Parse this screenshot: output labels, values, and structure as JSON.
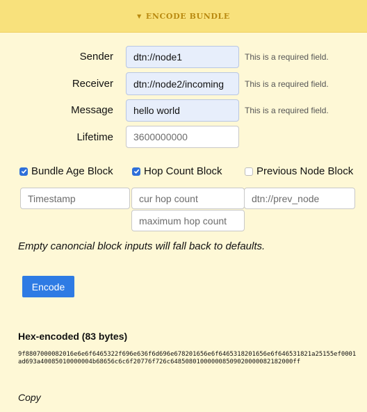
{
  "header": {
    "caret": "▼",
    "title": "ENCODE BUNDLE"
  },
  "form": {
    "sender": {
      "label": "Sender",
      "value": "dtn://node1",
      "hint": "This is a required field."
    },
    "receiver": {
      "label": "Receiver",
      "value": "dtn://node2/incoming",
      "hint": "This is a required field."
    },
    "message": {
      "label": "Message",
      "value": "hello world",
      "hint": "This is a required field."
    },
    "lifetime": {
      "label": "Lifetime",
      "placeholder": "3600000000"
    }
  },
  "blocks": {
    "bundle_age": {
      "label": "Bundle Age Block",
      "checked": true,
      "timestamp_placeholder": "Timestamp"
    },
    "hop_count": {
      "label": "Hop Count Block",
      "checked": true,
      "cur_placeholder": "cur hop count",
      "max_placeholder": "maximum hop count"
    },
    "previous_node": {
      "label": "Previous Node Block",
      "checked": false,
      "node_placeholder": "dtn://prev_node"
    }
  },
  "note": "Empty canoncial block inputs will fall back to defaults.",
  "encode_button": "Encode",
  "result": {
    "title": "Hex-encoded (83 bytes)",
    "hex": "9f8807000082016e6e6f6465322f696e636f6d696e678201656e6f6465318201656e6f646531821a25155ef0001ad693a40085010000004b68656c6c6f20776f726c648508010000008509020000082182000ff",
    "copy": "Copy"
  }
}
